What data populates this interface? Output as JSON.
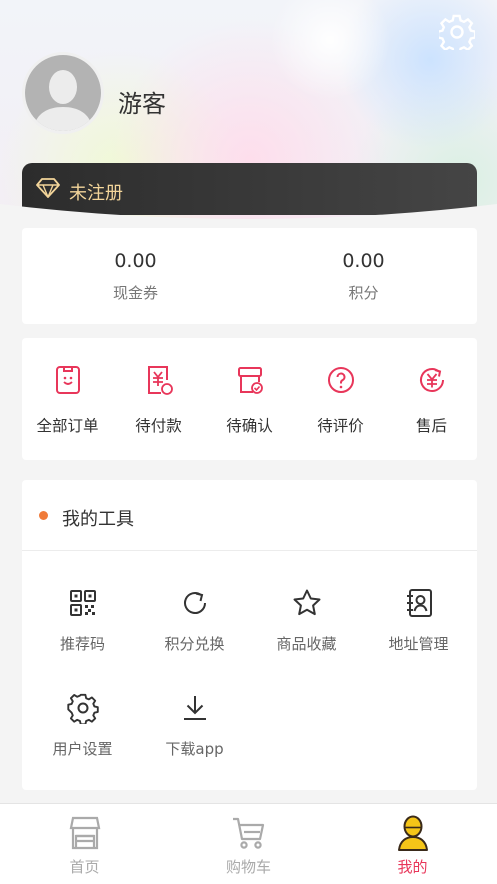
{
  "header": {
    "username": "游客",
    "member_status": "未注册"
  },
  "stats": [
    {
      "value": "0.00",
      "label": "现金券"
    },
    {
      "value": "0.00",
      "label": "积分"
    }
  ],
  "orders": [
    {
      "label": "全部订单",
      "icon": "order-list-icon"
    },
    {
      "label": "待付款",
      "icon": "pending-payment-icon"
    },
    {
      "label": "待确认",
      "icon": "pending-confirm-icon"
    },
    {
      "label": "待评价",
      "icon": "pending-review-icon"
    },
    {
      "label": "售后",
      "icon": "after-sales-icon"
    }
  ],
  "tools": {
    "title": "我的工具",
    "items": [
      {
        "label": "推荐码",
        "icon": "qr-code-icon"
      },
      {
        "label": "积分兑换",
        "icon": "refresh-icon"
      },
      {
        "label": "商品收藏",
        "icon": "star-icon"
      },
      {
        "label": "地址管理",
        "icon": "address-book-icon"
      },
      {
        "label": "用户设置",
        "icon": "gear-icon"
      },
      {
        "label": "下载app",
        "icon": "download-icon"
      }
    ]
  },
  "tabbar": [
    {
      "label": "首页",
      "icon": "shop-icon",
      "active": false
    },
    {
      "label": "购物车",
      "icon": "cart-icon",
      "active": false
    },
    {
      "label": "我的",
      "icon": "user-icon",
      "active": true
    }
  ],
  "colors": {
    "accent": "#e8365a",
    "gold": "#f3d59a",
    "dot": "#f07b3a",
    "bar": "#2c2c2c"
  }
}
